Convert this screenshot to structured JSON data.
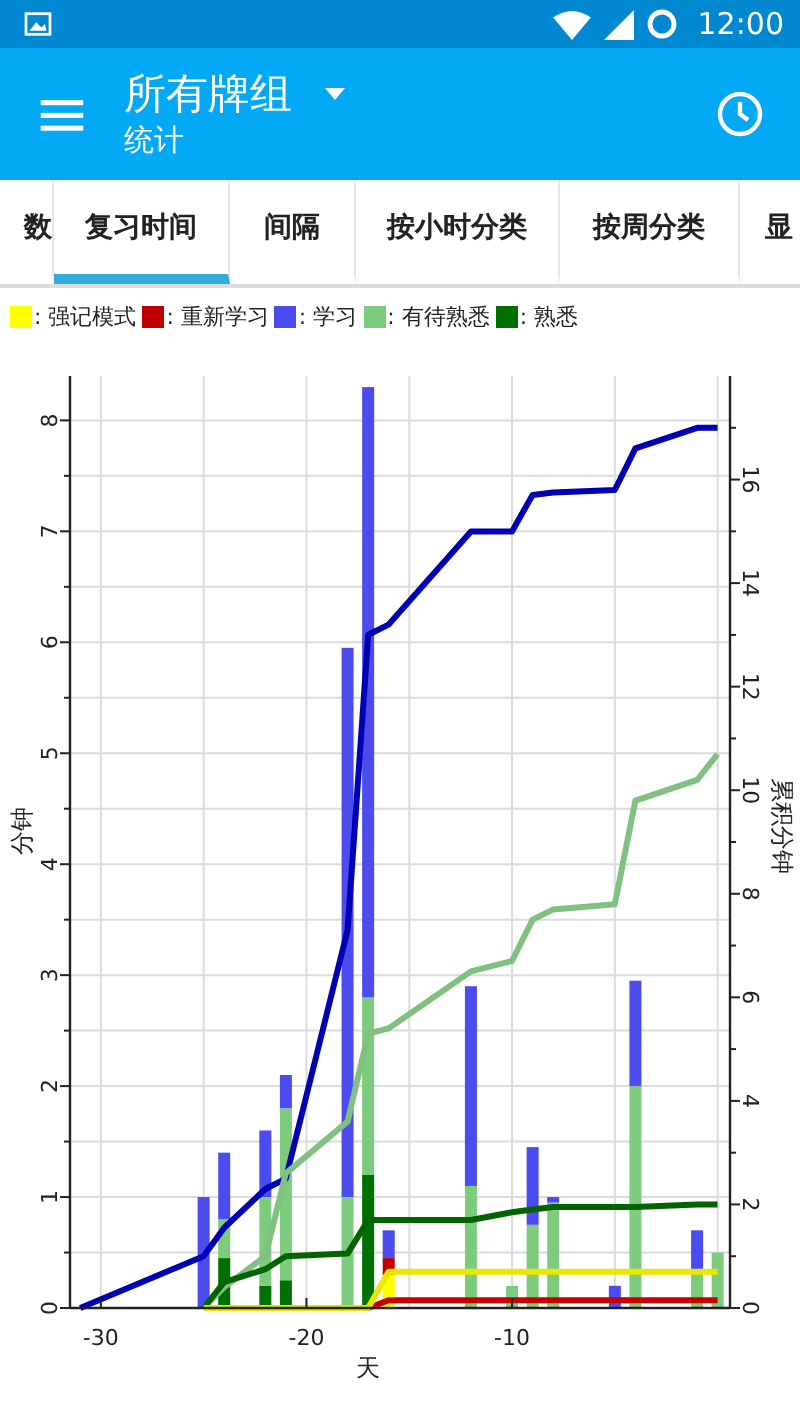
{
  "status_bar": {
    "time": "12:00"
  },
  "toolbar": {
    "title": "所有牌组",
    "subtitle": "统计"
  },
  "tabs": [
    {
      "label": "数",
      "selected": false
    },
    {
      "label": "复习时间",
      "selected": true
    },
    {
      "label": "间隔",
      "selected": false
    },
    {
      "label": "按小时分类",
      "selected": false
    },
    {
      "label": "按周分类",
      "selected": false
    },
    {
      "label": "显",
      "selected": false
    }
  ],
  "chart": {
    "chart_data": {
      "type": "bar",
      "stacked": true,
      "grid": true,
      "xlabel": "天",
      "ylabel": "分钟",
      "y2label": "累积分钟",
      "x": [
        -31,
        -25,
        -24,
        -22,
        -21,
        -18,
        -17,
        -16,
        -12,
        -10,
        -9,
        -8,
        -5,
        -4,
        -1,
        0
      ],
      "xlim": [
        -31.5,
        0.6
      ],
      "ylim": [
        0,
        8.4
      ],
      "y2lim": [
        0,
        18
      ],
      "xticks": [
        -30,
        -20,
        -10
      ],
      "yticks": [
        0,
        1,
        2,
        3,
        4,
        5,
        6,
        7,
        8
      ],
      "y2ticks": [
        0,
        2,
        4,
        6,
        8,
        10,
        12,
        14,
        16
      ],
      "series": [
        {
          "name": ": 强记模式",
          "color": "#ffff00",
          "values": [
            null,
            0,
            0,
            0,
            0,
            0,
            0,
            0.3,
            0,
            0,
            0,
            0,
            0,
            0,
            0,
            0
          ]
        },
        {
          "name": ": 重新学习",
          "color": "#c00000",
          "values": [
            null,
            0,
            0,
            0,
            0,
            0,
            0,
            0.15,
            0,
            0,
            0,
            0,
            0,
            0,
            0,
            0
          ]
        },
        {
          "name": ": 学习",
          "color": "#4b4bf0",
          "values": [
            null,
            1.0,
            0.6,
            0.6,
            0.3,
            4.95,
            5.5,
            0.25,
            1.8,
            0,
            0.7,
            0.05,
            0.2,
            0.95,
            0.35,
            0
          ]
        },
        {
          "name": ": 有待熟悉",
          "color": "#7dcc7d",
          "values": [
            null,
            0,
            0.35,
            0.8,
            1.55,
            1.0,
            1.6,
            0,
            1.1,
            0.2,
            0.75,
            0.95,
            0,
            2.0,
            0.35,
            0.5
          ]
        },
        {
          "name": ": 熟悉",
          "color": "#007000",
          "values": [
            null,
            0,
            0.45,
            0.2,
            0.25,
            0,
            1.2,
            0,
            0,
            null,
            0,
            null,
            0,
            0,
            0,
            0
          ]
        },
        {
          "type": "line",
          "axis": "y2",
          "color": "#0000b4",
          "values": [
            0,
            1.0,
            1.55,
            2.3,
            2.5,
            7.3,
            13.0,
            13.2,
            15.0,
            15.0,
            15.7,
            15.75,
            15.8,
            16.6,
            17.0,
            17.0
          ]
        },
        {
          "type": "line",
          "axis": "y2",
          "color": "#80c080",
          "values": [
            null,
            0,
            0.4,
            1.0,
            2.6,
            3.6,
            5.3,
            5.4,
            6.5,
            6.7,
            7.5,
            7.7,
            7.8,
            9.8,
            10.2,
            10.7
          ]
        },
        {
          "type": "line",
          "axis": "y2",
          "color": "#006400",
          "values": [
            null,
            0,
            0.5,
            0.75,
            1.0,
            1.05,
            1.7,
            1.7,
            1.7,
            1.85,
            1.9,
            1.95,
            1.95,
            1.95,
            2.0,
            2.0
          ]
        },
        {
          "type": "line",
          "axis": "y2",
          "color": "#c80000",
          "values": [
            null,
            null,
            null,
            null,
            null,
            null,
            0,
            0.15,
            0.15,
            0.15,
            0.15,
            0.15,
            0.15,
            0.15,
            0.15,
            0.15
          ]
        },
        {
          "type": "line",
          "axis": "y2",
          "color": "#e8e800",
          "values": [
            null,
            0,
            0,
            0,
            0,
            0,
            0,
            0.7,
            0.7,
            0.7,
            0.7,
            0.7,
            0.7,
            0.7,
            0.7,
            0.7
          ]
        }
      ]
    }
  }
}
